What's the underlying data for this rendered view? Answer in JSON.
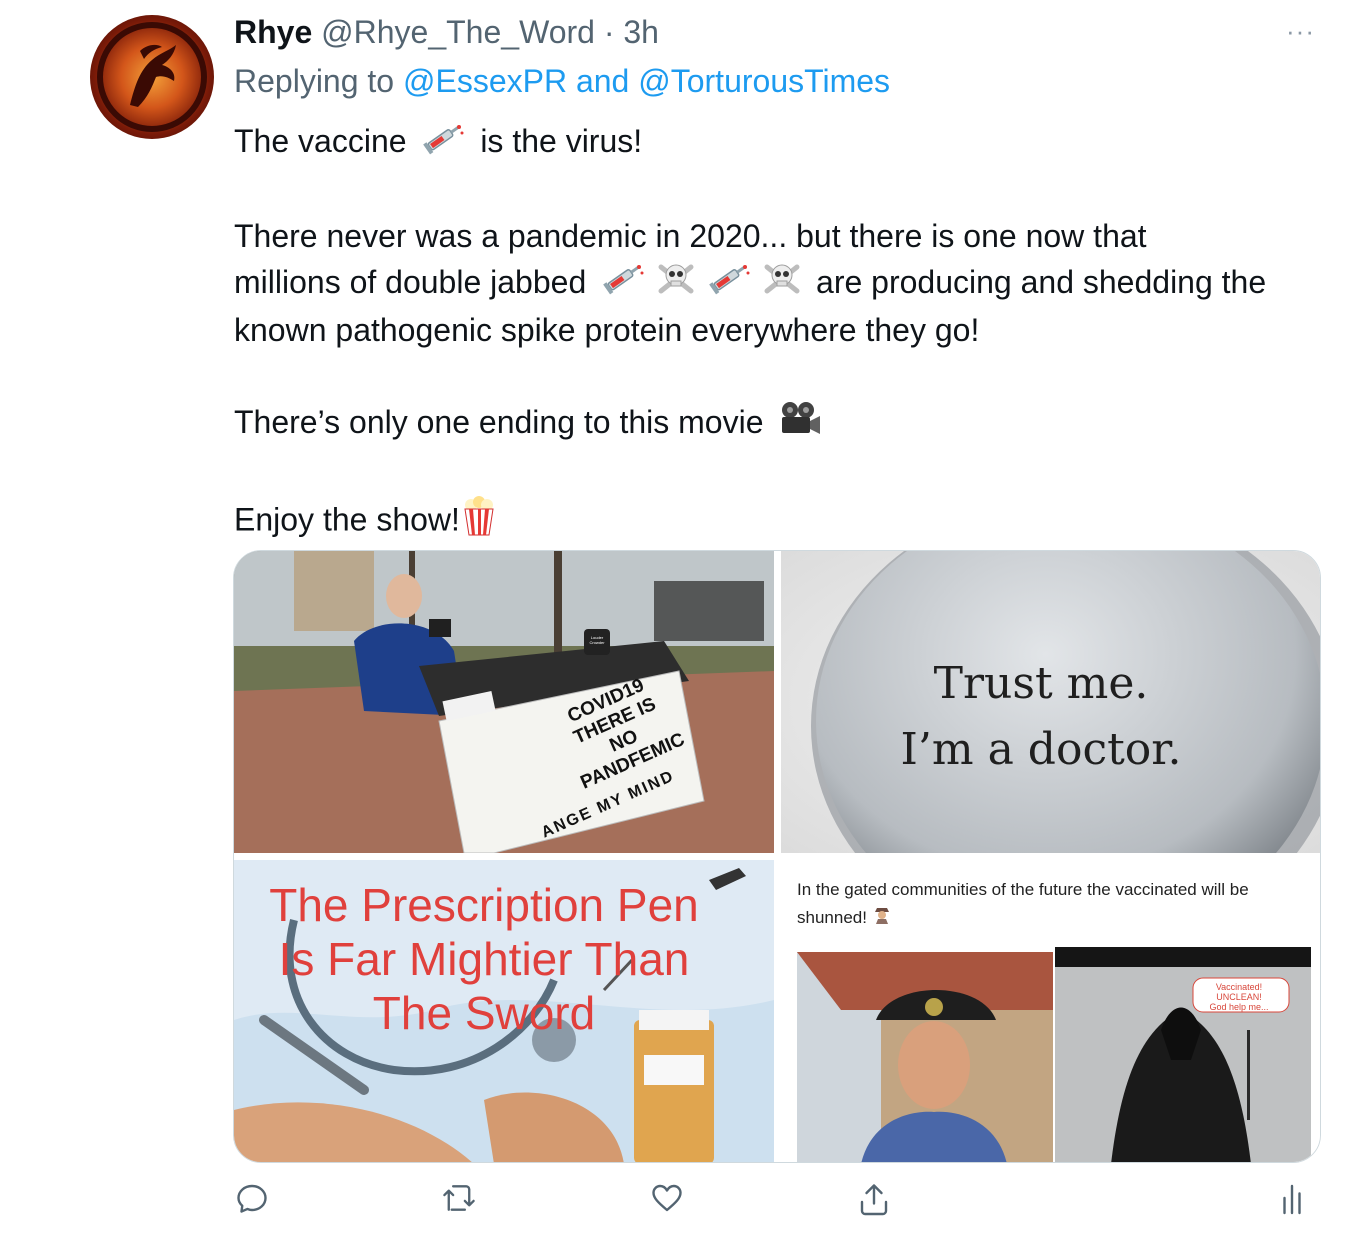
{
  "tweet": {
    "author_name": "Rhye",
    "author_handle": "@Rhye_The_Word",
    "separator": "·",
    "time": "3h",
    "more_label": "···",
    "reply_prefix": "Replying to",
    "reply_mention_1": "@EssexPR",
    "reply_and": "and",
    "reply_mention_2": "@TorturousTimes",
    "text": {
      "line1_a": "The vaccine",
      "line1_b": "is the virus!",
      "para2_line1": "There never was a pandemic in 2020... but there is one now that",
      "para2_line2_a": "millions of double jabbed",
      "para2_line2_b": "are producing and shedding the",
      "para2_line3": "known pathogenic spike protein everywhere they go!",
      "para3": "There’s only one ending to this movie",
      "para4": "Enjoy the show!"
    },
    "emojis": [
      "syringe-icon",
      "skull-crossbones-icon",
      "movie-camera-icon",
      "popcorn-icon",
      "detective-icon"
    ]
  },
  "media": {
    "tile1": {
      "sign_line1": "COVID19",
      "sign_line2": "THERE IS",
      "sign_line3": "NO",
      "sign_line4": "PANDFEMIC",
      "sign_bottom": "ANGE MY MIND",
      "mug_text": "Louder Crowder"
    },
    "tile2": {
      "badge_line1": "Trust me.",
      "badge_line2": "I’m a doctor."
    },
    "tile3": {
      "title_line1": "The Prescription Pen",
      "title_line2": "Is Far Mightier Than",
      "title_line3": "The Sword"
    },
    "tile4": {
      "caption": "In the gated communities of the future the vaccinated will be shunned!",
      "badge_line1": "Vaccinated!",
      "badge_line2": "UNCLEAN!",
      "badge_line3": "God help me..."
    }
  },
  "actions": {
    "icons": [
      "reply-icon",
      "retweet-icon",
      "like-icon",
      "share-icon",
      "analytics-icon"
    ]
  },
  "colors": {
    "link": "#1d9bf0",
    "secondary_text": "#536471",
    "pen_title": "#e0403c"
  }
}
